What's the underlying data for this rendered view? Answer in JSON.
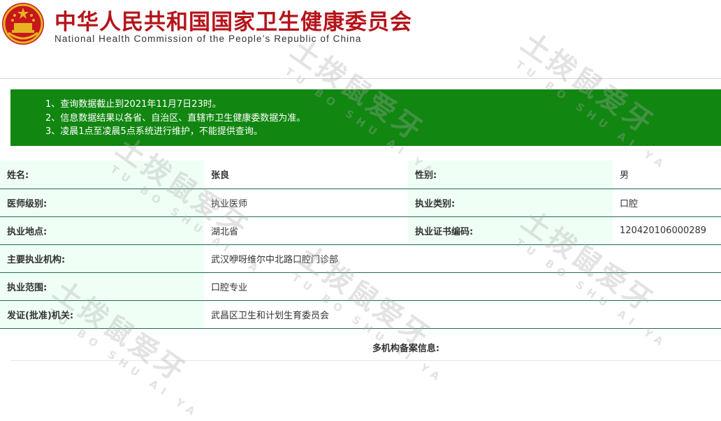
{
  "header": {
    "title_cn": "中华人民共和国国家卫生健康委员会",
    "title_en": "National Health Commission of the People’s Republic of China"
  },
  "notice": {
    "lines": [
      "1、查询数据截止到2021年11月7日23时。",
      "2、信息数据结果以各省、自治区、直辖市卫生健康委数据为准。",
      "3、凌晨1点至凌晨5点系统进行维护，不能提供查询。"
    ]
  },
  "info": {
    "name_label": "姓名:",
    "name_value": "张良",
    "gender_label": "性别:",
    "gender_value": "男",
    "level_label": "医师级别:",
    "level_value": "执业医师",
    "category_label": "执业类别:",
    "category_value": "口腔",
    "location_label": "执业地点:",
    "location_value": "湖北省",
    "cert_label": "执业证书编码:",
    "cert_value": "120420106000289",
    "org_label": "主要执业机构:",
    "org_value": "武汉咿呀维尔中北路口腔门诊部",
    "scope_label": "执业范围:",
    "scope_value": "口腔专业",
    "issuer_label": "发证(批准)机关:",
    "issuer_value": "武昌区卫生和计划生育委员会"
  },
  "multi_label": "多机构备案信息:",
  "watermark": {
    "cn": "土拨鼠爱牙",
    "en": "TU BO SHU AI YA"
  },
  "colors": {
    "title_red": "#b5141b",
    "notice_green": "#118611",
    "label_bg": "#f0fff6",
    "row_border": "#1f6b55"
  }
}
